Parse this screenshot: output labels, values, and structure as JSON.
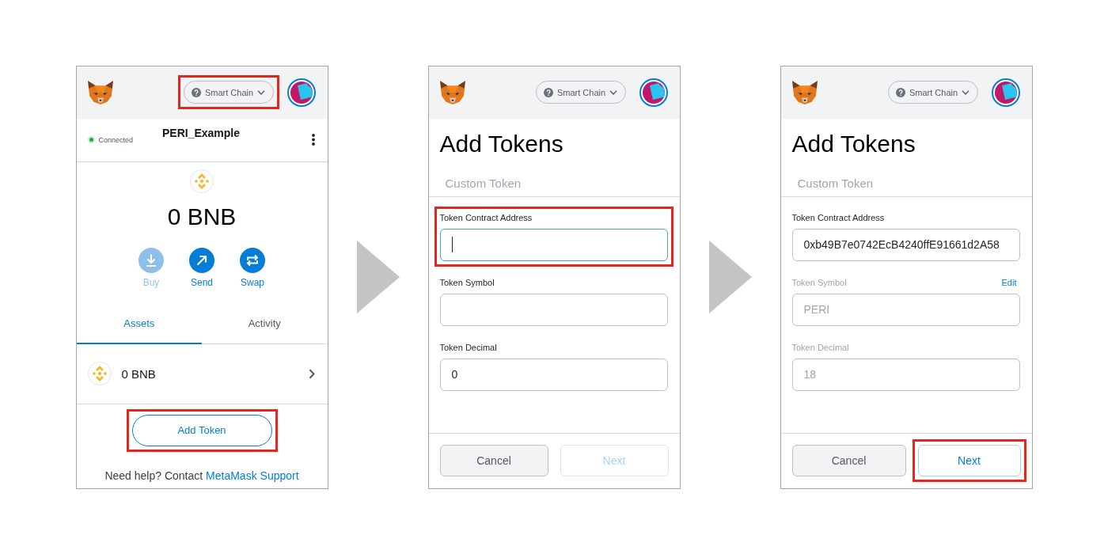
{
  "screens": [
    {
      "kind": "wallet",
      "header": {
        "network": "Smart Chain",
        "highlighted": true
      },
      "account": {
        "status": "Connected",
        "connected": true,
        "name": "PERI_Example"
      },
      "balance": "0 BNB",
      "actions": [
        {
          "kind": "buy",
          "label": "Buy",
          "disabled": true
        },
        {
          "kind": "send",
          "label": "Send",
          "disabled": false
        },
        {
          "kind": "swap",
          "label": "Swap",
          "disabled": false
        }
      ],
      "tabs": [
        {
          "label": "Assets",
          "selected": true
        },
        {
          "label": "Activity",
          "selected": false
        }
      ],
      "assets": [
        {
          "amount": "0 BNB"
        }
      ],
      "add_token_button": {
        "label": "Add Token",
        "highlighted": true
      },
      "help": {
        "text": "Need help? Contact",
        "link": "MetaMask Support"
      }
    },
    {
      "kind": "add_tokens",
      "header": {
        "network": "Smart Chain",
        "highlighted": false
      },
      "title": "Add Tokens",
      "tab": "Custom Token",
      "fields": [
        {
          "label": "Token Contract Address",
          "focused": true,
          "disabled": false,
          "highlighted": true
        },
        {
          "label": "Token Symbol",
          "focused": false,
          "disabled": false,
          "highlighted": false
        },
        {
          "label": "Token Decimal",
          "value": "0",
          "focused": false,
          "disabled": false,
          "highlighted": false
        }
      ],
      "buttons": [
        {
          "kind": "secondary",
          "label": "Cancel",
          "disabled": false,
          "highlighted": false
        },
        {
          "kind": "primary",
          "label": "Next",
          "disabled": true,
          "highlighted": false
        }
      ]
    },
    {
      "kind": "add_tokens",
      "header": {
        "network": "Smart Chain",
        "highlighted": false
      },
      "title": "Add Tokens",
      "tab": "Custom Token",
      "fields": [
        {
          "label": "Token Contract Address",
          "value": "0xb49B7e0742EcB4240ffE91661d2A58",
          "focused": false,
          "disabled": false,
          "highlighted": false
        },
        {
          "label": "Token Symbol",
          "action": "Edit",
          "value": "PERI",
          "focused": false,
          "disabled": true,
          "highlighted": false
        },
        {
          "label": "Token Decimal",
          "value": "18",
          "focused": false,
          "disabled": true,
          "highlighted": false
        }
      ],
      "buttons": [
        {
          "kind": "secondary",
          "label": "Cancel",
          "disabled": false,
          "highlighted": false
        },
        {
          "kind": "primary",
          "label": "Next",
          "disabled": false,
          "highlighted": true
        }
      ]
    }
  ]
}
